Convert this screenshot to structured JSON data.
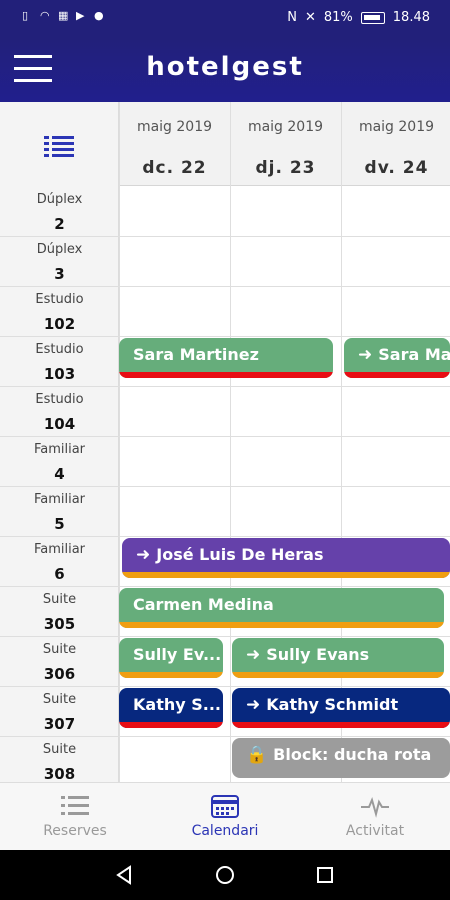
{
  "status_bar": {
    "battery": "81%",
    "time": "18.48"
  },
  "app": {
    "title": "hotelgest"
  },
  "calendar": {
    "days": [
      {
        "month": "maig 2019",
        "date": "dc. 22"
      },
      {
        "month": "maig 2019",
        "date": "dj. 23"
      },
      {
        "month": "maig 2019",
        "date": "dv. 24"
      }
    ],
    "rooms": [
      {
        "type": "Dúplex",
        "number": "2"
      },
      {
        "type": "Dúplex",
        "number": "3"
      },
      {
        "type": "Estudio",
        "number": "102"
      },
      {
        "type": "Estudio",
        "number": "103"
      },
      {
        "type": "Estudio",
        "number": "104"
      },
      {
        "type": "Familiar",
        "number": "4"
      },
      {
        "type": "Familiar",
        "number": "5"
      },
      {
        "type": "Familiar",
        "number": "6"
      },
      {
        "type": "Suite",
        "number": "305"
      },
      {
        "type": "Suite",
        "number": "306"
      },
      {
        "type": "Suite",
        "number": "307"
      },
      {
        "type": "Suite",
        "number": "308"
      }
    ],
    "bookings": [
      {
        "name": "Sara Martinez"
      },
      {
        "name": "Sara Martinez",
        "icon": "check-out-icon"
      },
      {
        "name": "José Luis De Heras",
        "icon": "check-in-icon"
      },
      {
        "name": "Carmen Medina"
      },
      {
        "name": "Sully Ev..."
      },
      {
        "name": "Sully Evans",
        "icon": "check-out-icon"
      },
      {
        "name": "Kathy S..."
      },
      {
        "name": "Kathy Schmidt",
        "icon": "check-out-icon"
      },
      {
        "name": "Block: ducha rota",
        "icon": "lock-icon"
      }
    ]
  },
  "bottom_nav": {
    "items": [
      {
        "label": "Reserves",
        "icon": "list-icon"
      },
      {
        "label": "Calendari",
        "icon": "calendar-icon",
        "active": true
      },
      {
        "label": "Activitat",
        "icon": "pulse-icon"
      }
    ]
  },
  "colors": {
    "brand": "#22207a",
    "booking_green": "#66ad7b",
    "booking_purple": "#6541aa",
    "booking_navy": "#07287f",
    "block_gray": "#9c9c9c"
  }
}
